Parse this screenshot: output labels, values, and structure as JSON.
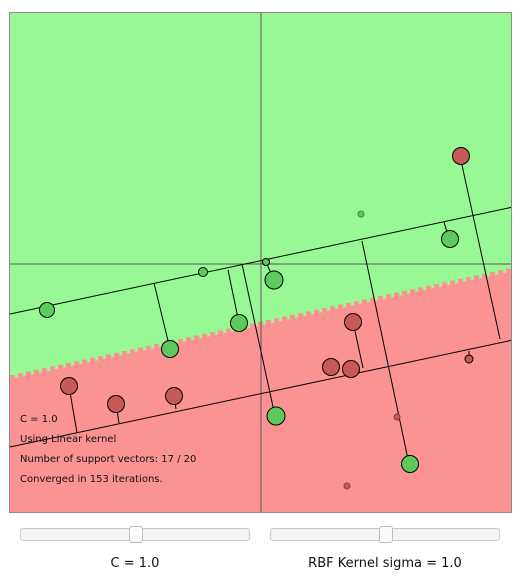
{
  "plot": {
    "colors": {
      "positive_region": "#98f994",
      "negative_region": "#fa9392",
      "positive_point": "#5ec95c",
      "negative_point": "#c85957",
      "frame": "#8c8c8c"
    },
    "info": {
      "c_line": "C = 1.0",
      "kernel_line": "Using Linear kernel",
      "sv_line": "Number of support vectors: 17 / 20",
      "iter_line": "Converged in 153 iterations."
    }
  },
  "controls": {
    "c_slider": {
      "label": "C = 1.0",
      "value": 1.0
    },
    "sigma_slider": {
      "label": "RBF Kernel sigma = 1.0",
      "value": 1.0
    }
  }
}
